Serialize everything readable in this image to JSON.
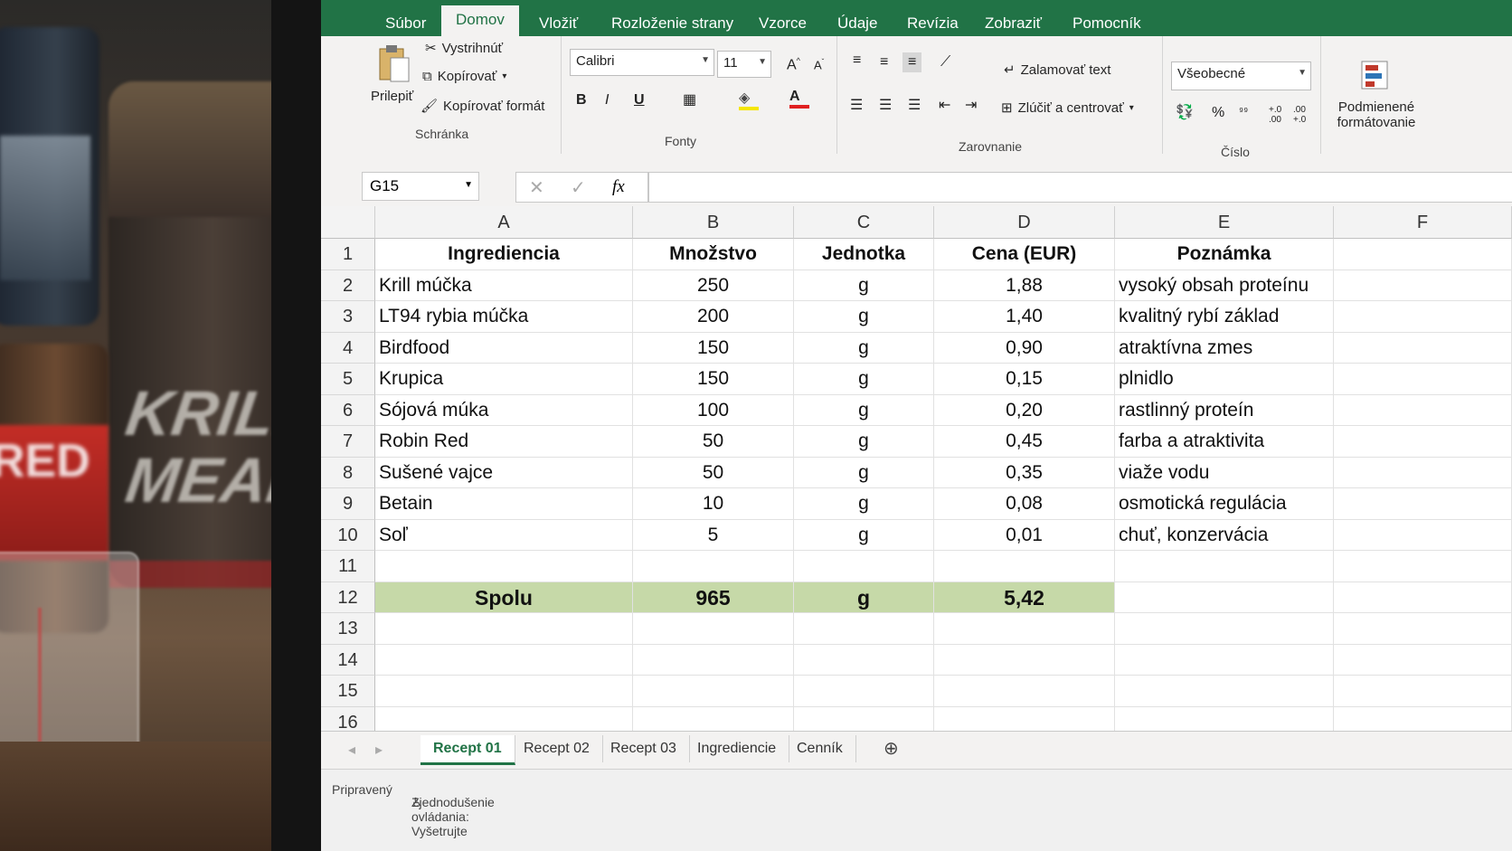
{
  "ribbon_tabs": [
    "Súbor",
    "Domov",
    "Vložiť",
    "Rozloženie strany",
    "Vzorce",
    "Údaje",
    "Revízia",
    "Zobraziť",
    "Pomocník"
  ],
  "clipboard": {
    "paste": "Prilepiť",
    "cut": "Vystrihnúť",
    "copy": "Kopírovať",
    "format_painter": "Kopírovať formát",
    "group": "Schránka"
  },
  "font": {
    "name": "Calibri",
    "size": "11",
    "group": "Fonty",
    "bold": "B",
    "italic": "I",
    "underline": "U"
  },
  "alignment": {
    "wrap": "Zalamovať text",
    "merge": "Zlúčiť a centrovať",
    "group": "Zarovnanie"
  },
  "number": {
    "format": "Všeobecné",
    "percent": "%",
    "group": "Číslo"
  },
  "styles": {
    "conditional": "Podmienené formátovanie"
  },
  "formula_bar": {
    "name_box": "G15",
    "fx": "fx",
    "value": ""
  },
  "columns": [
    "A",
    "B",
    "C",
    "D",
    "E",
    "F"
  ],
  "rows": [
    "1",
    "2",
    "3",
    "4",
    "5",
    "6",
    "7",
    "8",
    "9",
    "10",
    "11",
    "12",
    "13",
    "14",
    "15",
    "16"
  ],
  "table": {
    "headers": [
      "Ingrediencia",
      "Množstvo",
      "Jednotka",
      "Cena (EUR)",
      "Poznámka"
    ],
    "data": [
      [
        "Krill múčka",
        "250",
        "g",
        "1,88",
        "vysoký obsah proteínu"
      ],
      [
        "LT94 rybia múčka",
        "200",
        "g",
        "1,40",
        "kvalitný rybí základ"
      ],
      [
        "Birdfood",
        "150",
        "g",
        "0,90",
        "atraktívna zmes"
      ],
      [
        "Krupica",
        "150",
        "g",
        "0,15",
        "plnidlo"
      ],
      [
        "Sójová múka",
        "100",
        "g",
        "0,20",
        "rastlinný proteín"
      ],
      [
        "Robin Red",
        "50",
        "g",
        "0,45",
        "farba a atraktivita"
      ],
      [
        "Sušené vajce",
        "50",
        "g",
        "0,35",
        "viaže vodu"
      ],
      [
        "Betain",
        "10",
        "g",
        "0,08",
        "osmotická regulácia"
      ],
      [
        "Soľ",
        "5",
        "g",
        "0,01",
        "chuť, konzervácia"
      ]
    ],
    "total": [
      "Spolu",
      "965",
      "g",
      "5,42"
    ]
  },
  "sheet_tabs": [
    "Recept 01",
    "Recept 02",
    "Recept 03",
    "Ingrediencie",
    "Cenník"
  ],
  "active_sheet": "Recept 01",
  "status": {
    "ready": "Pripravený",
    "accessibility": "Zjednodušenie ovládania: Vyšetrujte"
  },
  "background": {
    "bag_text_line1": "KRILL",
    "bag_text_line2": "MEAL",
    "jar_text": "RED"
  },
  "colors": {
    "excel_green": "#217346",
    "total_fill": "#c6d9a8"
  }
}
